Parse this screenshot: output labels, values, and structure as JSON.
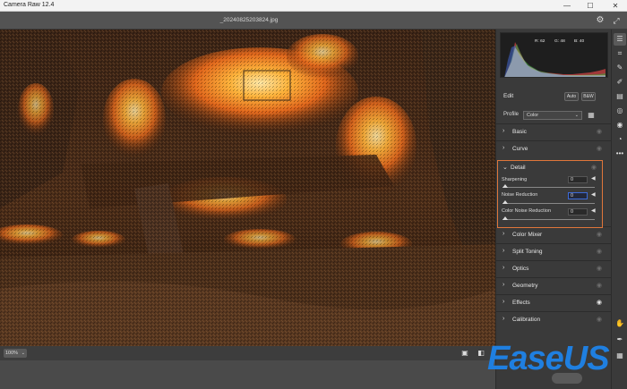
{
  "window": {
    "title": "Camera Raw 12.4",
    "minimize": "—",
    "maximize": "☐",
    "close": "✕"
  },
  "topbar": {
    "filename": "_20240825203824.jpg"
  },
  "histogram": {
    "r_label": "R: 62",
    "g_label": "G: 48",
    "b_label": "B: 40"
  },
  "edit": {
    "title": "Edit",
    "auto_label": "Auto",
    "bw_label": "B&W"
  },
  "profile": {
    "label": "Profile",
    "value": "Color"
  },
  "sections": {
    "basic": "Basic",
    "curve": "Curve",
    "color_mixer": "Color Mixer",
    "split_toning": "Split Toning",
    "optics": "Optics",
    "geometry": "Geometry",
    "effects": "Effects",
    "calibration": "Calibration"
  },
  "detail": {
    "title": "Detail",
    "sharpening": {
      "label": "Sharpening",
      "value": "0"
    },
    "noise_reduction": {
      "label": "Noise Reduction",
      "value": "0"
    },
    "color_noise_reduction": {
      "label": "Color Noise Reduction",
      "value": "0"
    }
  },
  "bottombar": {
    "zoom": "100%"
  },
  "watermark": {
    "text": "EaseUS"
  },
  "colors": {
    "accent_highlight": "#e0763a",
    "panel_bg": "#3a3a3a",
    "watermark_blue": "#1f7fe0"
  },
  "icons": {
    "gear": "gear-icon",
    "fullscreen": "fullscreen-icon",
    "edit_tool": "sliders-icon",
    "crop": "crop-icon",
    "heal": "heal-brush-icon",
    "brush": "brush-icon",
    "gradient": "gradient-icon",
    "radial": "radial-filter-icon",
    "redeye": "red-eye-icon",
    "presets": "presets-icon",
    "more": "more-icon",
    "hand": "hand-icon",
    "sampler": "color-sampler-icon",
    "grid": "grid-icon"
  }
}
